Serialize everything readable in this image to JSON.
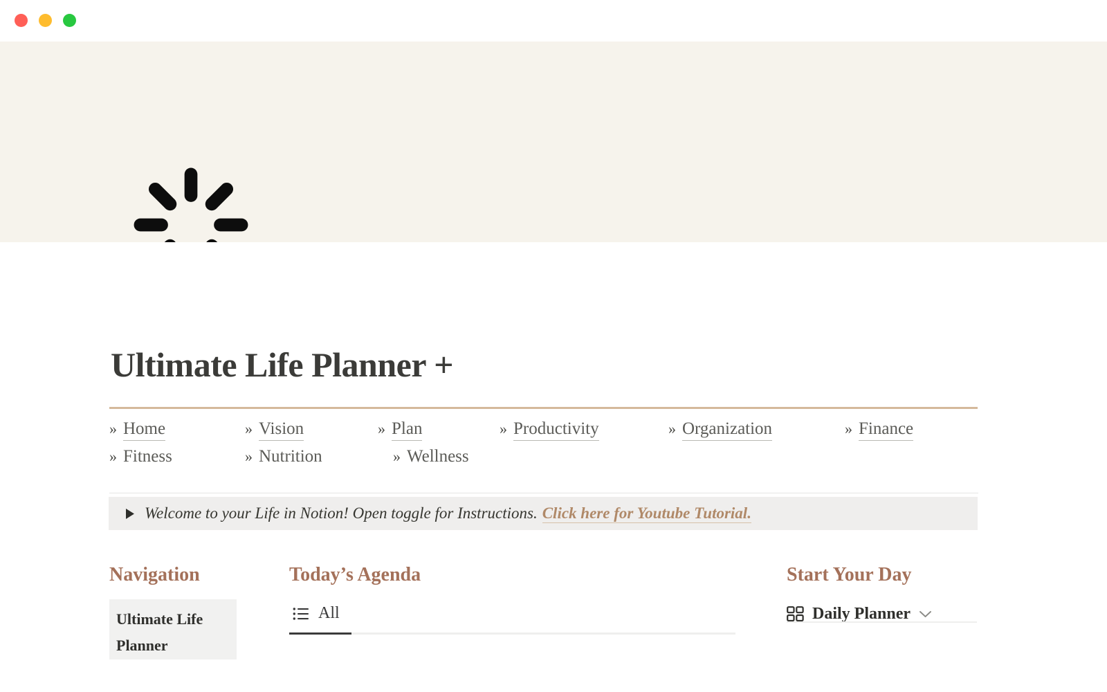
{
  "window": {
    "controls": [
      {
        "name": "close",
        "color": "#ff5f57"
      },
      {
        "name": "minimize",
        "color": "#febc2e"
      },
      {
        "name": "zoom",
        "color": "#28c840"
      }
    ]
  },
  "cover": {
    "background_color": "#f6f3ec",
    "icon": "loading-spinner-icon"
  },
  "page": {
    "title": "Ultimate Life Planner +",
    "title_color": "#3b3b38",
    "divider_color": "#d5b99b"
  },
  "nav_links": {
    "row1": [
      {
        "marker": "»",
        "label": "Home",
        "underlined": true
      },
      {
        "marker": "»",
        "label": "Vision",
        "underlined": true
      },
      {
        "marker": "»",
        "label": "Plan",
        "underlined": true
      },
      {
        "marker": "»",
        "label": "Productivity",
        "underlined": true
      },
      {
        "marker": "»",
        "label": "Organization",
        "underlined": true
      },
      {
        "marker": "»",
        "label": "Finance",
        "underlined": true
      }
    ],
    "row2": [
      {
        "marker": "»",
        "label": "Fitness",
        "underlined": false
      },
      {
        "marker": "»",
        "label": "Nutrition",
        "underlined": false
      },
      {
        "marker": "»",
        "label": "Wellness",
        "underlined": false
      }
    ]
  },
  "callout": {
    "toggle_icon": "triangle-right-icon",
    "text": "Welcome to your Life in Notion! Open toggle for Instructions.",
    "link_text": "Click here for Youtube Tutorial.",
    "link_color": "#b08968",
    "background_color": "#efeeed"
  },
  "columns": {
    "navigation": {
      "heading": "Navigation",
      "heading_color": "#a4715a",
      "card_label": "Ultimate Life Planner",
      "card_background": "#f1f1f0"
    },
    "agenda": {
      "heading": "Today’s Agenda",
      "heading_color": "#a4715a",
      "tabs": [
        {
          "icon": "list-view-icon",
          "label": "All",
          "active": true
        }
      ],
      "indicator_color": "#3b3b3b"
    },
    "start_your_day": {
      "heading": "Start Your Day",
      "heading_color": "#a4715a",
      "view": {
        "icon": "gallery-view-icon",
        "label": "Daily Planner",
        "chevron": "chevron-down-icon"
      }
    }
  }
}
